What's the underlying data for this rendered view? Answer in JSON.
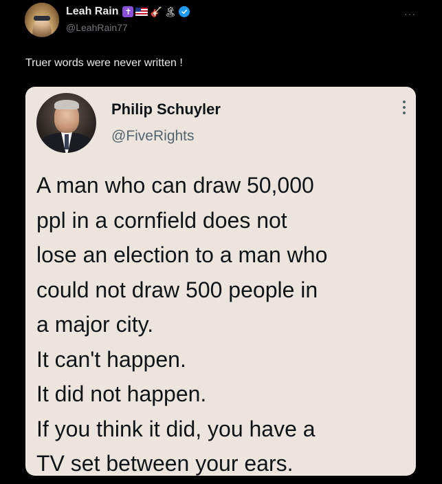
{
  "post": {
    "author": {
      "name": "Leah Rain",
      "handle": "@LeahRain77",
      "badges": [
        "cross-icon",
        "us-flag-icon",
        "guitar-icon",
        "island-icon",
        "verified-icon"
      ],
      "badge_glyphs": {
        "cross": "✝",
        "guitar": "🎸",
        "island": "🏝"
      }
    },
    "more_label": "···",
    "text": "Truer words were never written !",
    "media": {
      "author": {
        "name": "Philip Schuyler",
        "handle": "@FiveRights"
      },
      "quote_lines": [
        "A man who can draw 50,000",
        "ppl in a cornfield does not",
        "lose an election to a man who",
        "could not draw 500 people in",
        "a major city.",
        "It can't happen.",
        "It did not happen.",
        "If you think it did, you have a",
        "TV set between your ears."
      ]
    }
  },
  "colors": {
    "background": "#000000",
    "text_primary": "#e7e9ea",
    "text_secondary": "#71767b",
    "verified_blue": "#1d9bf0",
    "media_background": "#ece5dd"
  }
}
